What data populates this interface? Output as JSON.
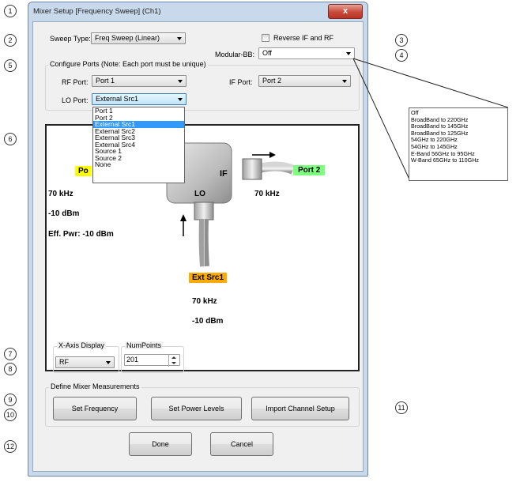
{
  "window": {
    "title": "Mixer Setup [Frequency Sweep] (Ch1)",
    "close_label": "x"
  },
  "sweep": {
    "label": "Sweep Type:",
    "value": "Freq Sweep (Linear)"
  },
  "reverse": {
    "label": "Reverse IF and RF",
    "checked": false
  },
  "modular": {
    "label": "Modular-BB:",
    "value": "Off"
  },
  "ports": {
    "group_title": "Configure Ports (Note: Each port must be unique)",
    "rf_label": "RF Port:",
    "rf_value": "Port 1",
    "if_label": "IF Port:",
    "if_value": "Port 2",
    "lo_label": "LO Port:",
    "lo_value": "External Src1"
  },
  "lo_options": [
    "Port 1",
    "Port 2",
    "External Src1",
    "External Src2",
    "External Src3",
    "External Src4",
    "Source 1",
    "Source 2",
    "None"
  ],
  "lo_selected_index": 2,
  "modular_options": [
    "Off",
    "BroadBand to 220GHz",
    "BroadBand to 145GHz",
    "BroadBand to 125GHz",
    "54GHz to 220GHz",
    "54GHz to 145GHz",
    "E-Band 56GHz to 95GHz",
    "W-Band 65GHz to 110GHz"
  ],
  "diagram": {
    "rf_port_tag": "Po",
    "if_port_tag": "Port 2",
    "lo_source_tag": "Ext Src1",
    "if_label": "IF",
    "lo_label": "LO",
    "rf_freq": "70 kHz",
    "rf_power": "-10 dBm",
    "rf_eff_power": "Eff. Pwr: -10 dBm",
    "if_freq": "70 kHz",
    "lo_freq": "70 kHz",
    "lo_power": "-10 dBm"
  },
  "xaxis": {
    "group_title": "X-Axis Display",
    "value": "RF"
  },
  "numpoints": {
    "group_title": "NumPoints",
    "value": "201"
  },
  "measurements": {
    "group_title": "Define Mixer Measurements",
    "set_frequency": "Set Frequency",
    "set_power_levels": "Set Power Levels",
    "import_channel_setup": "Import Channel Setup"
  },
  "footer": {
    "done": "Done",
    "cancel": "Cancel"
  },
  "callouts": [
    "1",
    "2",
    "3",
    "4",
    "5",
    "6",
    "7",
    "8",
    "9",
    "10",
    "11",
    "12"
  ],
  "colors": {
    "port_tag": "#7fff7f",
    "rf_tag": "#ffff00",
    "src_tag": "#ffaa00",
    "selection": "#3399ff"
  }
}
